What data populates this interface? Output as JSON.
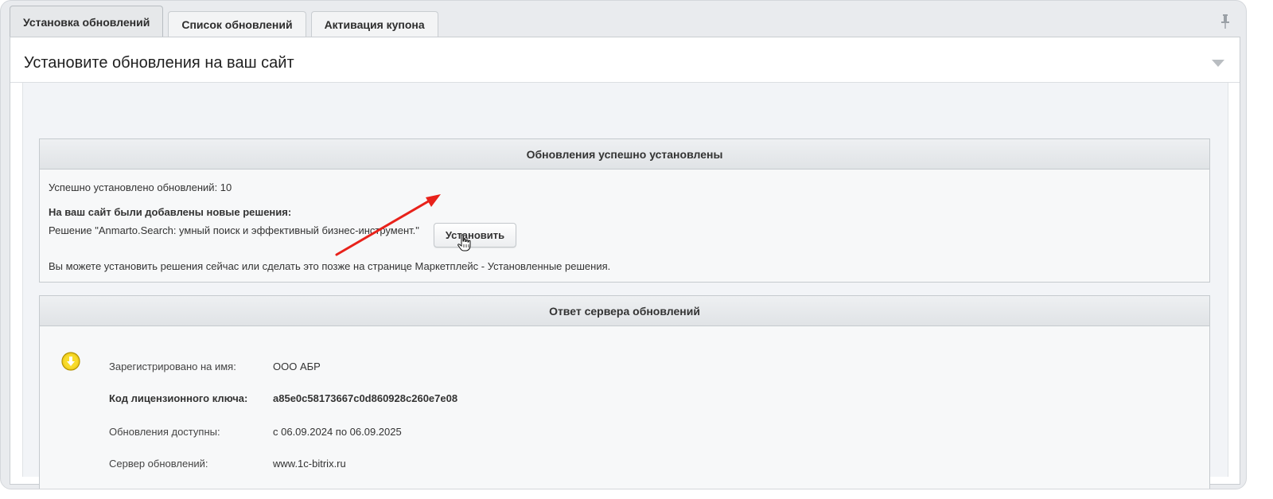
{
  "tabs": [
    {
      "label": "Установка обновлений",
      "active": true
    },
    {
      "label": "Список обновлений",
      "active": false
    },
    {
      "label": "Активация купона",
      "active": false
    }
  ],
  "icons": {
    "pin": "pin-icon",
    "collapse": "triangle-down-icon",
    "status": "down-arrow-circle-icon",
    "cursor": "hand-pointer-icon",
    "annotation": "red-arrow"
  },
  "colors": {
    "status_icon": "#e6c21a",
    "annotation_arrow": "#e8221b"
  },
  "page": {
    "title": "Установите обновления на ваш сайт"
  },
  "success_section": {
    "header": "Обновления успешно установлены",
    "installed_count_text": "Успешно установлено обновлений: 10",
    "new_solutions_heading": "На ваш сайт были добавлены новые решения:",
    "solution_text": "Решение \"Anmarto.Search: умный поиск и эффективный бизнес-инструмент.\"",
    "install_button": "Установить",
    "note": "Вы можете установить решения сейчас или сделать это позже на странице Маркетплейс - Установленные решения."
  },
  "server_section": {
    "header": "Ответ сервера обновлений",
    "rows": [
      {
        "label": "Зарегистрировано на имя:",
        "value": "ООО АБР"
      },
      {
        "label": "Код лицензионного ключа:",
        "value": "a85e0c58173667c0d860928c260e7e08"
      },
      {
        "label": "Обновления доступны:",
        "value": "с 06.09.2024 по 06.09.2025"
      },
      {
        "label": "Сервер обновлений:",
        "value": "www.1c-bitrix.ru"
      }
    ]
  }
}
